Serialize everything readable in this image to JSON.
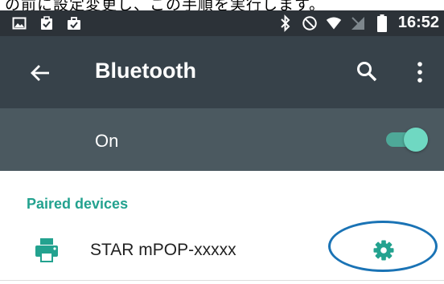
{
  "caption": "の前に設定変更し、この手順を実行します。",
  "status_bar": {
    "time": "16:52",
    "left_icons": [
      "image-icon",
      "clipboard-check-icon",
      "briefcase-check-icon"
    ],
    "right_icons": [
      "bluetooth-icon",
      "do-not-disturb-icon",
      "wifi-icon",
      "no-sim-icon",
      "battery-icon"
    ]
  },
  "app_bar": {
    "title": "Bluetooth",
    "back_icon": "arrow-back-icon",
    "search_icon": "search-icon",
    "more_icon": "more-vert-icon"
  },
  "toggle_row": {
    "label": "On",
    "state": true
  },
  "paired_section": {
    "header": "Paired devices",
    "devices": [
      {
        "name": "STAR mPOP-xxxxx",
        "icon": "printer-icon",
        "settings_icon": "gear-icon"
      }
    ]
  },
  "colors": {
    "status_bar": "#2c3238",
    "app_bar": "#37424a",
    "toggle_row": "#4b5960",
    "accent": "#23a28f",
    "annotation": "#1a73b5"
  }
}
